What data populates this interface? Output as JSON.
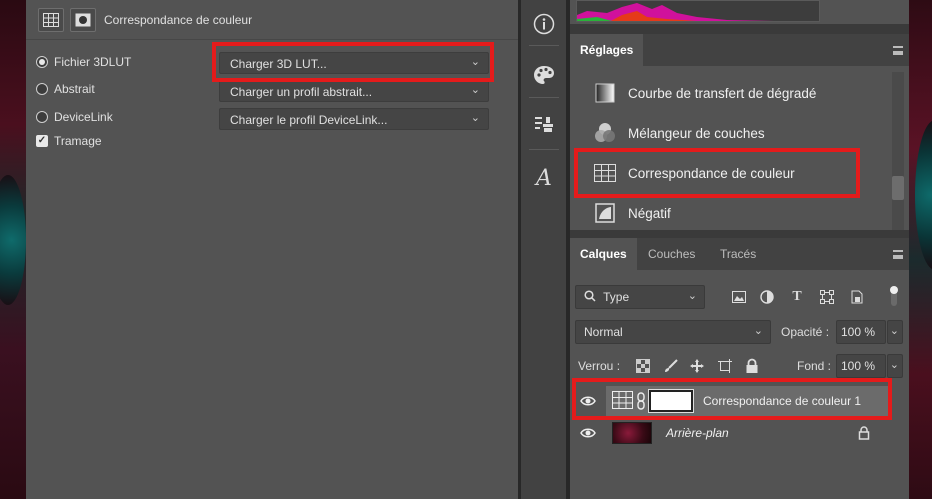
{
  "properties": {
    "title": "Correspondance de couleur",
    "options": [
      {
        "label": "Fichier 3DLUT",
        "type": "radio",
        "checked": true
      },
      {
        "label": "Abstrait",
        "type": "radio",
        "checked": false
      },
      {
        "label": "DeviceLink",
        "type": "radio",
        "checked": false
      },
      {
        "label": "Tramage",
        "type": "checkbox",
        "checked": true
      }
    ],
    "dropdowns": [
      {
        "value": "Charger 3D LUT..."
      },
      {
        "value": "Charger un profil abstrait..."
      },
      {
        "value": "Charger le profil DeviceLink..."
      }
    ]
  },
  "adjustments": {
    "tab": "Réglages",
    "items": [
      {
        "label": "Courbe de transfert de dégradé",
        "icon": "gradient-map-icon"
      },
      {
        "label": "Mélangeur de couches",
        "icon": "channel-mixer-icon"
      },
      {
        "label": "Correspondance de couleur",
        "icon": "color-lookup-icon"
      },
      {
        "label": "Négatif",
        "icon": "invert-icon"
      }
    ]
  },
  "layers_panel": {
    "tabs": [
      "Calques",
      "Couches",
      "Tracés"
    ],
    "filter_label": "Type",
    "blend_mode": "Normal",
    "opacity_label": "Opacité :",
    "opacity_value": "100 %",
    "lock_label": "Verrou :",
    "fill_label": "Fond :",
    "fill_value": "100 %",
    "layers": [
      {
        "name": "Correspondance de couleur 1",
        "selected": true,
        "visible": true
      },
      {
        "name": "Arrière-plan",
        "selected": false,
        "visible": true,
        "locked": true
      }
    ]
  },
  "colors": {
    "highlight": "#e41b1b",
    "panel": "#535353"
  }
}
